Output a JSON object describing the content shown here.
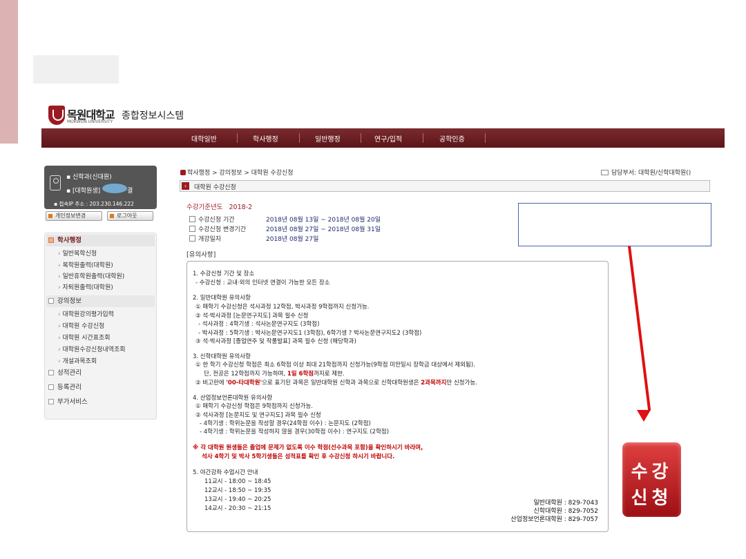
{
  "header": {
    "logo_name": "목원대학교",
    "logo_en": "MOKWON UNIVERSITY",
    "system_title": "종합정보시스템"
  },
  "nav": [
    "대학일반",
    "학사행정",
    "일반행정",
    "연구/입적",
    "공학인증"
  ],
  "user": {
    "line1": "신학과(신대원)",
    "line2_prefix": "[대학원생]",
    "line2_suffix": "결",
    "ip": "접속IP 주소 : 203.230.146.222",
    "btn_profile": "개인정보변경",
    "btn_logout": "로그아웃"
  },
  "menu": {
    "academic": "학사행정",
    "academic_items": [
      "일반복학신청",
      "복학원출력(대학원)",
      "일반휴학원출력(대학원)",
      "자퇴원출력(대학원)"
    ],
    "course_info": "강의정보",
    "course_items": [
      "대학원강의평가입력",
      "대학원 수강신청",
      "대학원 시간표조회",
      "대학원수강신청내역조회",
      "개설과목조회"
    ],
    "grades": "성적관리",
    "registration": "등록관리",
    "extra": "부가서비스"
  },
  "breadcrumb": "학사행정 > 강의정보 > 대학원 수강신청",
  "dept": "담당부서: 대학원/신학대학원()",
  "page_title": "대학원 수강신청",
  "period": {
    "year_label": "수강기준년도",
    "year": "2018-2",
    "rows": [
      {
        "label": "수강신청 기간",
        "value": "2018년 08월 13일   ~ 2018년 08월 20일"
      },
      {
        "label": "수강신청 변경기간",
        "value": "2018년 08월 27일   ~ 2018년 08월 31일"
      },
      {
        "label": "개강일자",
        "value": "2018년 08월 27일"
      }
    ]
  },
  "notes_title": "[유의사항]",
  "notice": {
    "s1": "1. 수강신청 기간 및 장소",
    "s1a": "- 수강신청 : 교내·외의 인터넷 연결이 가능한 모든 장소",
    "s2": "2. 일반대학원 유의사항",
    "s2a": "① 매학기 수강신청은 석사과정 12학점, 박사과정 9학점까지 신청가능.",
    "s2b": "② 석·박사과정 [논문연구지도] 과목 필수 신청",
    "s2c": "- 석사과정 : 4학기생 : 석사논문연구지도 (3학점)",
    "s2d": "- 박사과정 : 5학기생 : 박사논문연구지도1 (3학점), 6학기생 ? 박사논문연구지도2 (3학점)",
    "s2e": "③ 석·박사과정 [졸업연주 및 작품발표] 과목 필수 신청 (해당학과)",
    "s3": "3. 신학대학원 유의사항",
    "s3a": "① 한 학기 수강신청 학점은 최소 6학점 이상 최대 21학점까지 신청가능(9학점 미만일시 장학금 대상에서 제외됨).",
    "s3b1": "단, 전공은 12학점까지 가능하며, ",
    "s3b2": "1일 6학점",
    "s3b3": "까지로 제한.",
    "s3c1": "② 비고란에 ",
    "s3c2": "'00-타대학원'",
    "s3c3": "으로 표기된 과목은 일반대학원 신학과 과목으로 신학대학원생은 ",
    "s3c4": "2과목까지",
    "s3c5": "만 신청가능.",
    "s4": "4. 산업정보언론대학원 유의사항",
    "s4a": "① 매학기 수강신청 학점은 9학점까지 신청가능.",
    "s4b": "② 석사과정 [논문지도 및 연구지도] 과목 필수 신청",
    "s4c": "- 4학기생 : 학위논문을 작성할 경우(24학점 이수) : 논문지도 (2학점)",
    "s4d": "- 4학기생 : 학위논문을 작성하지 않을 경우(30학점 이수) : 연구지도 (2학점)",
    "warn1": "※ 각 대학원 원생들은 졸업에 문제가 없도록 이수 학점(선수과목 포함)을 확인하시기 바라며,",
    "warn2": "석사 4학기 및 박사 5학기생들은 성적표를 확인 후 수강신청 하시기 바랍니다.",
    "s5": "5. 야간강좌 수업시간 안내",
    "times": [
      "11교시 - 18:00 ~ 18:45",
      "12교시 - 18:50 ~ 19:35",
      "13교시 - 19:40 ~ 20:25",
      "14교시 - 20:30 ~ 21:15"
    ],
    "contacts": [
      "일반대학원 : 829-7043",
      "신학대학원 : 829-7052",
      "산업정보언론대학원 : 829-7057"
    ]
  },
  "reg_button": {
    "line1": "수강",
    "line2": "신청"
  },
  "colors": {
    "brand": "#9c1a22",
    "arrow": "#e01010",
    "highlight_box": "#4466aa"
  }
}
